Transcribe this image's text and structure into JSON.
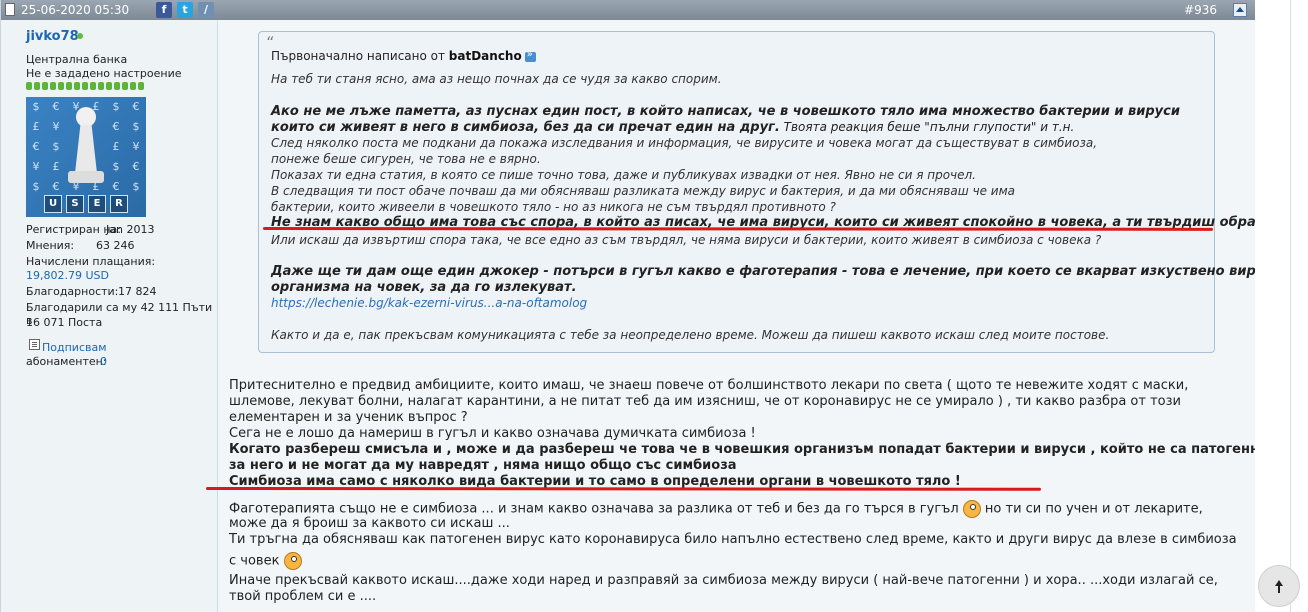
{
  "header": {
    "date": "25-06-2020 05:30",
    "post_number": "#936",
    "icons": [
      "facebook-icon",
      "twitter-icon",
      "link-icon"
    ]
  },
  "user": {
    "name": "jivko78",
    "title": "Централна банка",
    "mood": "Не е зададено настроение",
    "stats": {
      "registered_label": "Регистриран на:",
      "registered_value": "Jan 2013",
      "posts_label": "Мнения:",
      "posts_value": "63 246",
      "payments_label": "Начислени плащания:",
      "payments_value": "19,802.79 USD",
      "thanks_label": "Благодарности:",
      "thanks_value": "17 824",
      "thanked_line1": "Благодарили са му 42 111 Пъти в",
      "thanked_line2": "16 071 Поста",
      "subscribe_label": "Подписвам",
      "subscribers_label": "абонаментен:",
      "subscribers_value": "0"
    },
    "avatar_text": [
      "U",
      "S",
      "E",
      "R"
    ]
  },
  "quote": {
    "header_prefix": "Първоначално написано от ",
    "author": "batDancho",
    "lines": [
      "На теб ти станя ясно, ама аз нещо почнах да се чудя за какво спорим.",
      "Ако не ме лъже паметта, аз пуснах един пост, в който написах, че в човешкото тяло има множество бактерии и вируси",
      "които си живеят в него в симбиоза, без да си пречат един на друг.",
      " Твоята реакция беше \"пълни глупости\" и т.н.",
      "След няколко поста ме подкани да покажа изследвания и информация, че вирусите и човека могат да съществуват в симбиоза,",
      "понеже беше сигурен, че това не е вярно.",
      "Показах ти една статия, в която се пише точно това, даже и публикувах извадки от нея. Явно не си я прочел.",
      "В следващия ти пост обаче почваш да ми обясняваш разликата между вирус и бактерия, и да ми обясняваш че има",
      "бактерии, които живеели в човешкото тяло - но аз никога не съм твърдял противното ?",
      "Не знам какво общо има това със спора, в който аз писах, че има вируси, които си живеят спокойно в човека, а ти твърдиш обратното ?",
      "Или искаш да извъртиш спора така, че все едно аз съм твърдял, че няма вируси и бактерии, които живеят в симбиоза с човека ?",
      "Даже ще ти дам още един джокер - потърси в гугъл какво е фаготерапия - това е лечение, при което се вкарват изкуствено вируси в",
      "организма на човек, за да го излекуват.",
      "https://lechenie.bg/kak-ezerni-virus...a-na-oftamolog",
      "Както и да е, пак прекъсвам комуникацията с тебе за неопределено време. Можеш да пишеш каквото искаш след моите постове."
    ]
  },
  "body": {
    "lines": [
      "Притеснително е предвид амбициите, които имаш, че знаеш повече от болшинството лекари по света ( щото те невежите ходят с маски,",
      "шлемове, лекуват болни, налагат карантини, а не питат теб да им изясниш, че от коронавирус не се умирало ) , ти какво разбра от този",
      "елементарен и за ученик въпрос ?",
      "Сега не е лошо да намериш в гугъл и какво означава думичката симбиоза !",
      "Когато разбереш смисъла и , може и да разбереш че това че в човешкия организъм попадат бактерии и вируси , който не са патогенни",
      "за него и не могат да му навредят , няма нищо общо със симбиоза",
      "Симбиоза има само с няколко вида бактерии и то само в определени органи в човешкото тяло !",
      "Фаготерапията също не е симбиоза ... и знам какво означава за разлика от теб и без да го търся в гугъл",
      " но ти си по учен и от лекарите,",
      "може да я броиш за каквото си искаш ...",
      "Ти тръгна да обясняваш как патогенен вирус като коронавируса било напълно естествено след време, както и други вирус да влезе в симбиоза",
      "с човек",
      "Иначе прекъсвай каквото искаш....даже ходи наред и разправяй за симбиоза между вируси ( най-вече патогенни ) и хора.. ...ходи излагай се,",
      "твой проблем си е ...."
    ]
  },
  "colors": {
    "username": "#1b4f8f",
    "link": "#1c66b5",
    "underline": "#d91a1a",
    "header_bar": "#8a96a2",
    "reputation": "#5cb536"
  }
}
